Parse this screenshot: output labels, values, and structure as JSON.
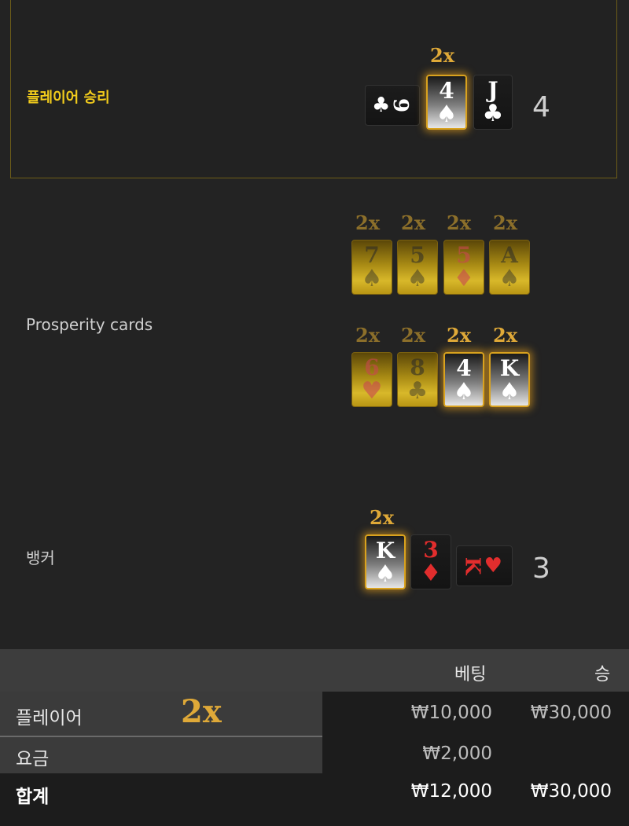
{
  "player": {
    "label": "플레이어 승리",
    "multiplier": "2x",
    "score": "4",
    "cards": [
      {
        "rank": "9",
        "suit": "♣"
      },
      {
        "rank": "4",
        "suit": "♠"
      },
      {
        "rank": "J",
        "suit": "♣"
      }
    ]
  },
  "prosperity": {
    "label": "Prosperity cards",
    "row1": [
      {
        "mult": "2x",
        "rank": "7",
        "suit": "♠"
      },
      {
        "mult": "2x",
        "rank": "5",
        "suit": "♠"
      },
      {
        "mult": "2x",
        "rank": "5",
        "suit": "♦"
      },
      {
        "mult": "2x",
        "rank": "A",
        "suit": "♠"
      }
    ],
    "row2": [
      {
        "mult": "2x",
        "rank": "6",
        "suit": "♥"
      },
      {
        "mult": "2x",
        "rank": "8",
        "suit": "♣"
      },
      {
        "mult": "2x",
        "rank": "4",
        "suit": "♠"
      },
      {
        "mult": "2x",
        "rank": "K",
        "suit": "♠"
      }
    ]
  },
  "banker": {
    "label": "뱅커",
    "multiplier": "2x",
    "score": "3",
    "cards": [
      {
        "rank": "K",
        "suit": "♠"
      },
      {
        "rank": "3",
        "suit": "♦"
      },
      {
        "rank": "K",
        "suit": "♥"
      }
    ]
  },
  "table": {
    "col_bet": "베팅",
    "col_win": "승",
    "rows": [
      {
        "label": "플레이어",
        "multiplier": "2x",
        "bet": "₩10,000",
        "win": "₩30,000"
      },
      {
        "label": "요금",
        "bet": "₩2,000",
        "win": ""
      },
      {
        "label": "합계",
        "bet": "₩12,000",
        "win": "₩30,000"
      }
    ]
  },
  "colors": {
    "accent_gold": "#dfa938",
    "winner_label": "#f2cc1c",
    "background": "#232323"
  }
}
